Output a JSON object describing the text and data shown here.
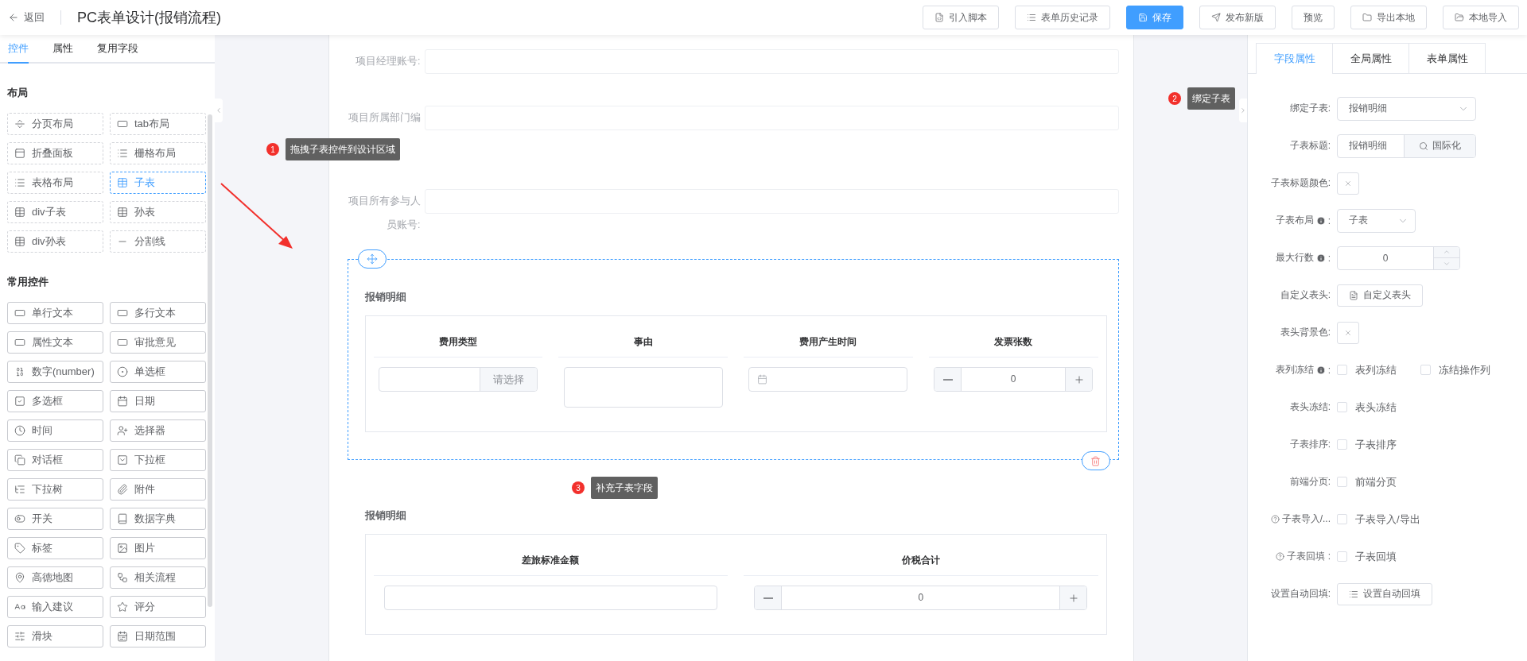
{
  "topbar": {
    "back": "返回",
    "title": "PC表单设计(报销流程)",
    "buttons": [
      {
        "label": "引入脚本",
        "primary": false
      },
      {
        "label": "表单历史记录",
        "primary": false
      },
      {
        "label": "保存",
        "primary": true
      },
      {
        "label": "发布新版",
        "primary": false
      },
      {
        "label": "预览",
        "primary": false
      },
      {
        "label": "导出本地",
        "primary": false
      },
      {
        "label": "本地导入",
        "primary": false
      }
    ]
  },
  "left_panel": {
    "tabs": [
      {
        "label": "控件",
        "selected": true
      },
      {
        "label": "属性",
        "selected": false
      },
      {
        "label": "复用字段",
        "selected": false
      }
    ],
    "sections": [
      {
        "title": "布局",
        "kind": "layout",
        "items": [
          {
            "label": "分页布局",
            "selected": false
          },
          {
            "label": "tab布局",
            "selected": false
          },
          {
            "label": "折叠面板",
            "selected": false
          },
          {
            "label": "栅格布局",
            "selected": false
          },
          {
            "label": "表格布局",
            "selected": false
          },
          {
            "label": "子表",
            "selected": true
          },
          {
            "label": "div子表",
            "selected": false
          },
          {
            "label": "孙表",
            "selected": false
          },
          {
            "label": "div孙表",
            "selected": false
          },
          {
            "label": "分割线",
            "selected": false
          }
        ]
      },
      {
        "title": "常用控件",
        "kind": "common",
        "items": [
          {
            "label": "单行文本",
            "selected": false
          },
          {
            "label": "多行文本",
            "selected": false
          },
          {
            "label": "属性文本",
            "selected": false
          },
          {
            "label": "审批意见",
            "selected": false
          },
          {
            "label": "数字(number)",
            "selected": false
          },
          {
            "label": "单选框",
            "selected": false
          },
          {
            "label": "多选框",
            "selected": false
          },
          {
            "label": "日期",
            "selected": false
          },
          {
            "label": "时间",
            "selected": false
          },
          {
            "label": "选择器",
            "selected": false
          },
          {
            "label": "对话框",
            "selected": false
          },
          {
            "label": "下拉框",
            "selected": false
          },
          {
            "label": "下拉树",
            "selected": false
          },
          {
            "label": "附件",
            "selected": false
          },
          {
            "label": "开关",
            "selected": false
          },
          {
            "label": "数据字典",
            "selected": false
          },
          {
            "label": "标签",
            "selected": false
          },
          {
            "label": "图片",
            "selected": false
          },
          {
            "label": "高德地图",
            "selected": false
          },
          {
            "label": "相关流程",
            "selected": false
          },
          {
            "label": "输入建议",
            "selected": false
          },
          {
            "label": "评分",
            "selected": false
          },
          {
            "label": "滑块",
            "selected": false
          },
          {
            "label": "日期范围",
            "selected": false
          }
        ]
      }
    ]
  },
  "canvas": {
    "form_rows": [
      {
        "label": "项目经理账号:"
      },
      {
        "label": "项目所属部门编"
      },
      {
        "label": "项目所有参与人员账号:"
      }
    ],
    "subtables": [
      {
        "title": "报销明细",
        "selected": true,
        "columns": [
          {
            "header": "费用类型",
            "kind": "select",
            "button": "请选择"
          },
          {
            "header": "事由",
            "kind": "textarea"
          },
          {
            "header": "费用产生时间",
            "kind": "date"
          },
          {
            "header": "发票张数",
            "kind": "number",
            "value": "0"
          }
        ]
      },
      {
        "title": "报销明细",
        "selected": false,
        "columns": [
          {
            "header": "差旅标准金额",
            "kind": "text"
          },
          {
            "header": "价税合计",
            "kind": "number",
            "value": "0"
          }
        ]
      }
    ]
  },
  "annotations": [
    {
      "number": "1",
      "text": "拖拽子表控件到设计区域"
    },
    {
      "number": "2",
      "text": "绑定子表"
    },
    {
      "number": "3",
      "text": "补充子表字段"
    }
  ],
  "right_panel": {
    "tabs": [
      {
        "label": "字段属性",
        "selected": true
      },
      {
        "label": "全局属性",
        "selected": false
      },
      {
        "label": "表单属性",
        "selected": false
      }
    ],
    "rows": [
      {
        "kind": "select",
        "label": "绑定子表:",
        "value": "报销明细"
      },
      {
        "kind": "input_button",
        "label": "子表标题:",
        "value": "报销明细",
        "button": "国际化"
      },
      {
        "kind": "color",
        "label": "子表标题颜色:"
      },
      {
        "kind": "small_select",
        "label": "子表布局",
        "info": true,
        "colon": ":",
        "value": "子表"
      },
      {
        "kind": "number",
        "label": "最大行数",
        "info": true,
        "colon": ":",
        "value": "0"
      },
      {
        "kind": "button",
        "label": "自定义表头:",
        "button": "自定义表头"
      },
      {
        "kind": "color",
        "label": "表头背景色:"
      },
      {
        "kind": "checks",
        "label": "表列冻结",
        "info": true,
        "colon": ":",
        "options": [
          {
            "label": "表列冻结",
            "checked": false
          },
          {
            "label": "冻结操作列",
            "checked": false
          }
        ]
      },
      {
        "kind": "checks",
        "label": "表头冻结:",
        "options": [
          {
            "label": "表头冻结",
            "checked": false
          }
        ]
      },
      {
        "kind": "checks",
        "label": "子表排序:",
        "options": [
          {
            "label": "子表排序",
            "checked": false
          }
        ]
      },
      {
        "kind": "checks",
        "label": "前端分页:",
        "options": [
          {
            "label": "前端分页",
            "checked": false
          }
        ]
      },
      {
        "kind": "checks",
        "label": "子表导入/...",
        "help": true,
        "options": [
          {
            "label": "子表导入/导出",
            "checked": false
          }
        ]
      },
      {
        "kind": "checks",
        "label": "子表回填 :",
        "help": true,
        "options": [
          {
            "label": "子表回填",
            "checked": false
          }
        ]
      },
      {
        "kind": "list_button",
        "label": "设置自动回填:",
        "button": "设置自动回填"
      }
    ]
  }
}
